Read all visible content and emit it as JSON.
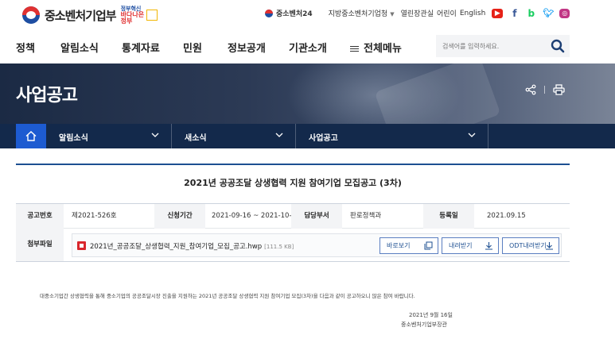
{
  "header": {
    "logo_text": "중소벤처기업부",
    "slogan_line1": "정부혁신",
    "slogan_line2": "바다나은 정부",
    "utils": {
      "sme24": "중소벤처24",
      "regional": "지방중소벤처기업청",
      "open_office": "열린장관실",
      "kids": "어린이",
      "english": "English"
    },
    "social_icons": [
      "youtube-icon",
      "facebook-icon",
      "blog-icon",
      "twitter-icon",
      "instagram-icon"
    ]
  },
  "nav": {
    "items": [
      "정책",
      "알림소식",
      "통계자료",
      "민원",
      "정보공개",
      "기관소개"
    ],
    "all_menu": "전체메뉴",
    "search_placeholder": "검색어를 입력하세요."
  },
  "banner": {
    "title": "사업공고"
  },
  "breadcrumb": {
    "items": [
      "알림소식",
      "새소식",
      "사업공고"
    ]
  },
  "post": {
    "title": "2021년 공공조달 상생협력 지원 참여기업 모집공고 (3차)",
    "meta": {
      "number_label": "공고번호",
      "number_value": "제2021-526호",
      "period_label": "신청기간",
      "period_value": "2021-09-16 ~ 2021-10-15",
      "dept_label": "담당부서",
      "dept_value": "판로정책과",
      "date_label": "등록일",
      "date_value": "2021.09.15"
    },
    "attachment": {
      "label": "첨부파일",
      "file_name": "2021년_공공조달_상생협력_지원_참여기업_모집_공고.hwp",
      "file_size": "[111.5 KB]",
      "preview_label": "바로보기",
      "download_label": "내려받기",
      "odt_label": "ODT내려받기"
    },
    "body": "대중소기업간 상생협력을 통해 중소기업의 공공조달시장 진출을 지원하는 2021년 공공조달 상생협력 지원 참여기업 모집(3차)을 다음과 같이 공고하오니 많은 참여 바랍니다.",
    "sign_date": "2021년 9월 16일",
    "sign_org": "중소벤처기업부장관"
  },
  "colors": {
    "brand_blue": "#1d4f91",
    "home_blue": "#1d5bd1",
    "breadcrumb_bg": "#13294b",
    "brand_red": "#e03131"
  }
}
